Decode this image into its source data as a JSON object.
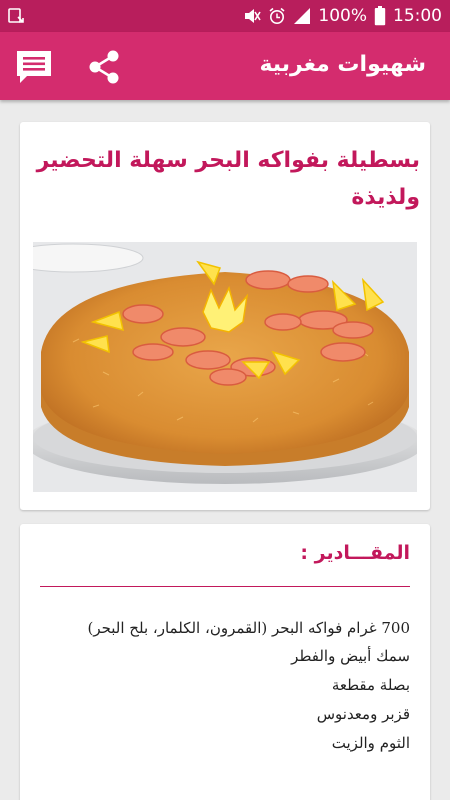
{
  "status_bar": {
    "battery_percent": "100%",
    "time": "15:00"
  },
  "app_bar": {
    "title": "شهيوات مغربية"
  },
  "recipe": {
    "title": "بسطيلة بفواكه البحر سهلة التحضير ولذيذة"
  },
  "ingredients": {
    "heading": "المقـــادير :",
    "items": [
      "700 غرام فواكه البحر (القمرون، الكلمار، بلح البحر)",
      "سمك أبيض والفطر",
      "بصلة مقطعة",
      "قزبر ومعدنوس",
      "الثوم والزيت"
    ]
  },
  "colors": {
    "status_bar": "#b81e5c",
    "app_bar": "#d42c6e",
    "accent_text": "#c2185b",
    "background": "#ebebeb"
  }
}
